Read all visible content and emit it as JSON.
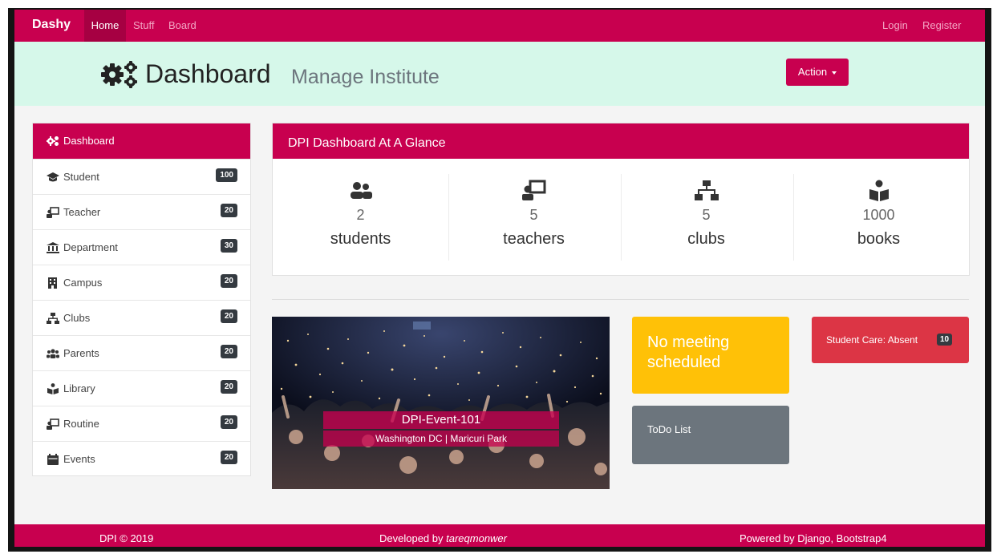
{
  "navbar": {
    "brand": "Dashy",
    "home": "Home",
    "stuff": "Stuff",
    "board": "Board",
    "login": "Login",
    "register": "Register"
  },
  "header": {
    "icon": "cogs-icon",
    "title": "Dashboard",
    "subtitle": "Manage Institute",
    "action_label": "Action"
  },
  "sidebar": {
    "active": {
      "label": "Dashboard",
      "icon": "cogs-icon"
    },
    "items": [
      {
        "label": "Student",
        "count": "100",
        "icon": "graduation-cap-icon"
      },
      {
        "label": "Teacher",
        "count": "20",
        "icon": "chalkboard-teacher-icon"
      },
      {
        "label": "Department",
        "count": "30",
        "icon": "university-icon"
      },
      {
        "label": "Campus",
        "count": "20",
        "icon": "building-icon"
      },
      {
        "label": "Clubs",
        "count": "20",
        "icon": "sitemap-icon"
      },
      {
        "label": "Parents",
        "count": "20",
        "icon": "users-icon"
      },
      {
        "label": "Library",
        "count": "20",
        "icon": "book-reader-icon"
      },
      {
        "label": "Routine",
        "count": "20",
        "icon": "chalkboard-teacher-icon"
      },
      {
        "label": "Events",
        "count": "20",
        "icon": "calendar-icon"
      }
    ]
  },
  "glance": {
    "title": "DPI Dashboard At A Glance",
    "stats": [
      {
        "value": "2",
        "label": "students",
        "icon": "user-friends-icon"
      },
      {
        "value": "5",
        "label": "teachers",
        "icon": "chalkboard-teacher-icon"
      },
      {
        "value": "5",
        "label": "clubs",
        "icon": "sitemap-icon"
      },
      {
        "value": "1000",
        "label": "books",
        "icon": "book-reader-icon"
      }
    ]
  },
  "event": {
    "title": "DPI-Event-101",
    "location": "Washington DC | Maricuri Park"
  },
  "cards": {
    "meeting": "No meeting scheduled",
    "todo": "ToDo List",
    "absent_label": "Student Care: Absent",
    "absent_count": "10"
  },
  "footer": {
    "copyright": "DPI © 2019",
    "developed_prefix": "Developed by",
    "developer": "tareqmonwer",
    "powered": "Powered by Django, Bootstrap4"
  },
  "colors": {
    "primary": "#c8004f",
    "header_bg": "#d6f8ea",
    "warning": "#ffc107",
    "secondary": "#6c757d",
    "danger": "#dc3545"
  }
}
